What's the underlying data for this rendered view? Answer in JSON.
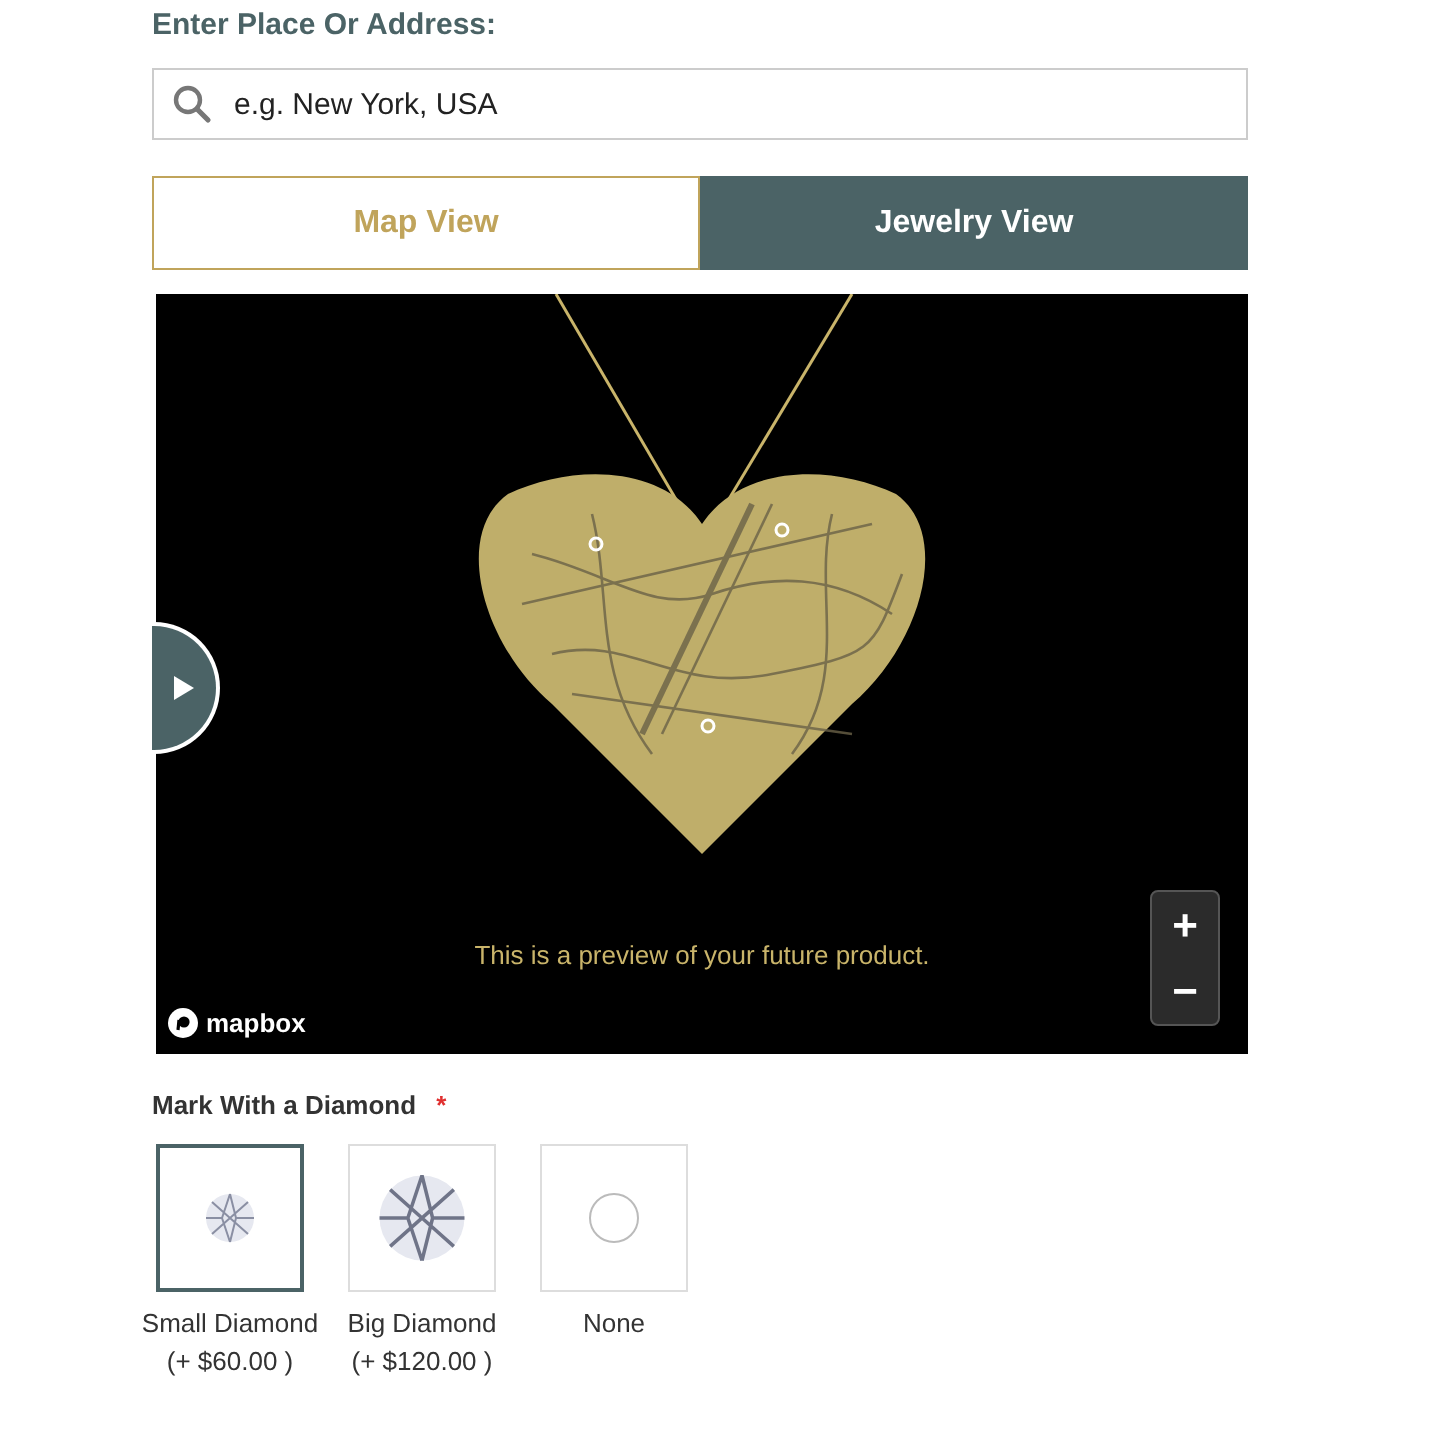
{
  "address_label": "Enter Place Or Address:",
  "search": {
    "placeholder": "e.g. New York, USA"
  },
  "tabs": [
    {
      "label": "Map View",
      "selected": false
    },
    {
      "label": "Jewelry View",
      "selected": true
    }
  ],
  "preview": {
    "caption": "This is a preview of your future product.",
    "attribution": "mapbox",
    "zoom_in": "+",
    "zoom_out": "−"
  },
  "diamond": {
    "label": "Mark With a Diamond",
    "required_mark": "*",
    "options": [
      {
        "kind": "small",
        "name": "Small Diamond",
        "price": "(+ $60.00 )",
        "selected": true
      },
      {
        "kind": "big",
        "name": "Big Diamond",
        "price": "(+ $120.00 )",
        "selected": false
      },
      {
        "kind": "none",
        "name": "None",
        "selected": false
      }
    ]
  }
}
